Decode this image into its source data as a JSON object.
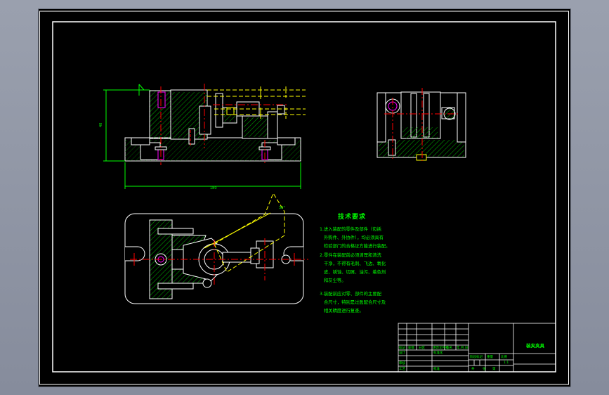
{
  "drawing": {
    "tech_requirements": {
      "title": "技术要求",
      "lines": [
        "1.进入装配的零件及部件（包括",
        "外购件、外协件），均必须具有",
        "检验部门的合格证方能进行装配。",
        "2.零件在装配前必须清理和清洗",
        "干净，不得有毛刺、飞边、氧化",
        "皮、锈蚀、切屑、油污、着色剂",
        "和灰尘等。",
        "3.装配前应对零、部件的主要配",
        "合尺寸，特别是过盈配合尺寸及",
        "相关精度进行复查。"
      ]
    },
    "dimensions": {
      "height": "40",
      "width": "180",
      "angle": "30°"
    },
    "title_block": {
      "part_name": "装夹夹具",
      "cells": {
        "biaoji": "标记",
        "chushu": "处数",
        "fenqu": "分区",
        "gengai": "更改文件号",
        "qianming": "签名",
        "nianyueri": "年.月.日",
        "sheji": "设计",
        "biaozhunhua": "标准化",
        "jieduan": "阶段标记",
        "zhongliang": "重量",
        "bili": "比例",
        "shenhe": "审核",
        "gongyi": "工艺",
        "pizhun": "批准",
        "gong": "共",
        "zhang": "张",
        "di": "第",
        "scale": "1:1"
      }
    }
  },
  "colors": {
    "background": "#000000",
    "frame": "#ffffff",
    "dimension": "#00ff00",
    "centerline": "#ff0000",
    "hatch": "#00c000",
    "hidden": "#ffff00",
    "thread": "#ff00ff",
    "text": "#00ff00"
  }
}
